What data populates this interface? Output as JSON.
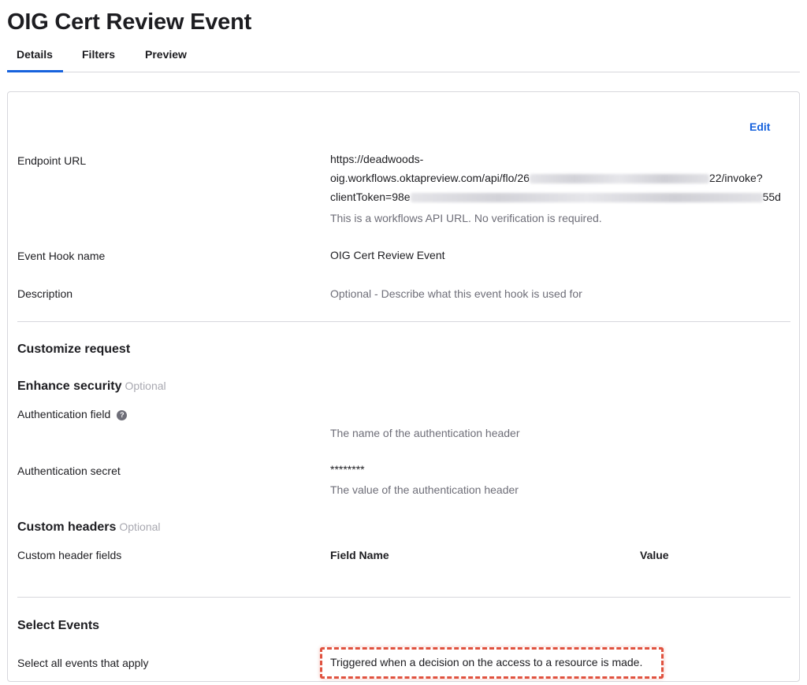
{
  "page": {
    "title": "OIG Cert Review Event"
  },
  "tabs": [
    {
      "label": "Details",
      "active": true
    },
    {
      "label": "Filters",
      "active": false
    },
    {
      "label": "Preview",
      "active": false
    }
  ],
  "details": {
    "edit_label": "Edit",
    "endpoint": {
      "label": "Endpoint URL",
      "line1": "https://deadwoods-",
      "line2_prefix": "oig.workflows.oktapreview.com/api/flo/26",
      "line2_suffix": "22/invoke?",
      "line3_prefix": "clientToken=98e",
      "line3_suffix": "55d",
      "hint": "This is a workflows API URL. No verification is required."
    },
    "name": {
      "label": "Event Hook name",
      "value": "OIG Cert Review Event"
    },
    "description": {
      "label": "Description",
      "placeholder": "Optional - Describe what this event hook is used for"
    }
  },
  "customize": {
    "title": "Customize request",
    "enhance_security": {
      "title": "Enhance security",
      "optional": "Optional"
    },
    "auth_field": {
      "label": "Authentication field",
      "help_icon": "?",
      "hint": "The name of the authentication header"
    },
    "auth_secret": {
      "label": "Authentication secret",
      "value": "********",
      "hint": "The value of the authentication header"
    },
    "custom_headers": {
      "title": "Custom headers",
      "optional": "Optional",
      "fields_label": "Custom header fields",
      "col_field_name": "Field Name",
      "col_value": "Value"
    }
  },
  "select_events": {
    "title": "Select Events",
    "label": "Select all events that apply",
    "event": "Triggered when a decision on the access to a resource is made."
  },
  "colors": {
    "accent": "#1662dd",
    "highlight": "#e0523f",
    "hint": "#6e6e78",
    "optional": "#a9a9b1",
    "border": "#d7d7dc"
  }
}
